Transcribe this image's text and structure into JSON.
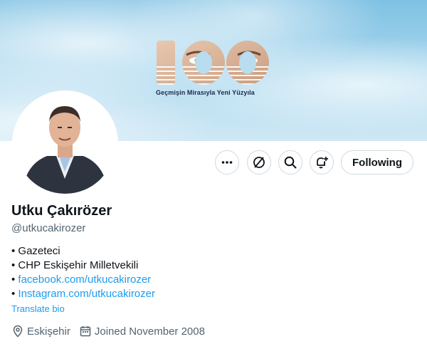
{
  "banner": {
    "logo_text": "100",
    "slogan": "Geçmişin Mirasıyla Yeni Yüzyıla"
  },
  "actions": {
    "more_icon": "more-dots-icon",
    "grok_icon": "slashed-circle-icon",
    "search_icon": "search-icon",
    "notify_icon": "bell-plus-icon",
    "following_label": "Following"
  },
  "profile": {
    "name": "Utku Çakırözer",
    "handle": "@utkucakirozer",
    "bio": [
      {
        "bullet": "• ",
        "text": "Gazeteci",
        "is_link": false
      },
      {
        "bullet": "• ",
        "text": "CHP Eskişehir Milletvekili",
        "is_link": false
      },
      {
        "bullet": "• ",
        "text": "facebook.com/utkucakirozer",
        "is_link": true
      },
      {
        "bullet": "• ",
        "text": "Instagram.com/utkucakirozer",
        "is_link": true
      }
    ],
    "translate_label": "Translate bio",
    "location": "Eskişehir",
    "joined": "Joined November 2008"
  },
  "colors": {
    "link": "#1d9bf0",
    "secondary_text": "#536471",
    "border": "#cfd9de"
  }
}
